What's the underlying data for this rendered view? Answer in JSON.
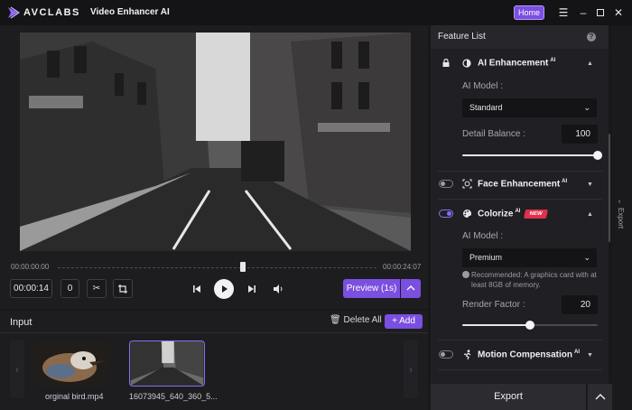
{
  "titlebar": {
    "brand": "AVCLABS",
    "app_name": "Video Enhancer AI",
    "home_label": "Home",
    "menu_icon": "hamburger-icon",
    "minimize_icon": "minimize-icon",
    "maximize_icon": "maximize-icon",
    "close_icon": "close-icon"
  },
  "player": {
    "start_time": "00:00:00:00",
    "end_time": "00:00:24:07",
    "position_fraction": 0.58,
    "current_time": "00:00:14",
    "frame": "0",
    "preview_label": "Preview (1s)"
  },
  "input": {
    "title": "Input",
    "delete_all_label": "Delete All",
    "add_label": "+ Add",
    "files": [
      {
        "name": "orginal bird.mp4",
        "selected": false
      },
      {
        "name": "16073945_640_360_5...",
        "selected": true
      }
    ]
  },
  "features": {
    "title": "Feature List",
    "ai_enhancement": {
      "title": "AI Enhancement",
      "ai_sup": "AI",
      "model_label": "AI Model :",
      "model_value": "Standard",
      "detail_label": "Detail Balance :",
      "detail_value": "100",
      "detail_fraction": 1.0
    },
    "face_enhancement": {
      "title": "Face Enhancement",
      "ai_sup": "AI",
      "enabled": false
    },
    "colorize": {
      "title": "Colorize",
      "ai_sup": "AI",
      "badge": "NEW",
      "enabled": true,
      "model_label": "AI Model :",
      "model_value": "Premium",
      "note": "Recommended: A graphics card with at least 8GB of memory.",
      "render_label": "Render Factor :",
      "render_value": "20",
      "render_fraction": 0.5
    },
    "motion_compensation": {
      "title": "Motion Compensation",
      "ai_sup": "AI",
      "enabled": false
    }
  },
  "export": {
    "label": "Export",
    "side_label": "Export"
  },
  "colors": {
    "accent": "#7b4fe0",
    "badge": "#e0304a",
    "panel": "#202024"
  }
}
